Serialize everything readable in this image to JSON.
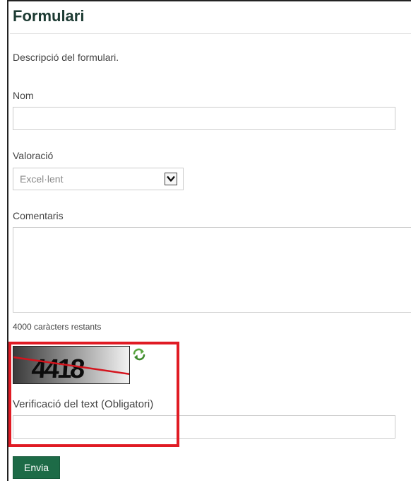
{
  "form": {
    "title": "Formulari",
    "description": "Descripció del formulari.",
    "name_field": {
      "label": "Nom",
      "value": "",
      "placeholder": ""
    },
    "rating_field": {
      "label": "Valoració",
      "selected": "Excel·lent"
    },
    "comments_field": {
      "label": "Comentaris",
      "value": "",
      "chars_remaining": "4000 caràcters restants"
    },
    "captcha": {
      "image_text": "4418",
      "refresh_icon": "refresh-arrows-icon",
      "refresh_color": "#5aa640",
      "verification_label": "Verificació del text (Obligatori)",
      "verification_value": ""
    },
    "submit_label": "Envia"
  },
  "colors": {
    "title": "#1d3b33",
    "button": "#1d6b47",
    "highlight": "#e01b24"
  }
}
